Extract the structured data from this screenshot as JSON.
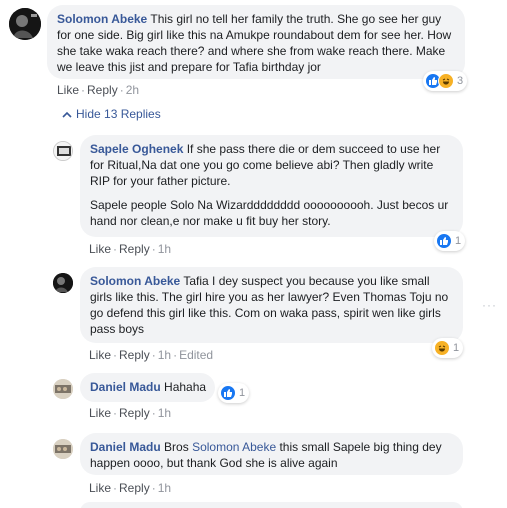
{
  "actions": {
    "like": "Like",
    "reply": "Reply",
    "edited": "Edited"
  },
  "hide_replies": "Hide 13 Replies",
  "comments": [
    {
      "author": "Solomon Abeke",
      "text": "This girl no tell her family the truth. She go see her guy for one side. Big girl like this na Amukpe roundabout dem for see her. How she take waka reach there? and where she from wake reach there. Make we leave this jist and prepare for Tafia birthday jor",
      "time": "2h",
      "reactions": {
        "icons": [
          "like-icon",
          "haha-icon"
        ],
        "count": "3"
      }
    },
    {
      "author": "Sapele Oghenek",
      "text": "If she pass there die or dem succeed to use her for Ritual,Na dat one you go come believe abi? Then gladly write RIP for your father picture.",
      "text2": "Sapele people Solo Na Wizardddddddd oooooooooh. Just becos ur hand nor clean,e nor make u fit buy her story.",
      "time": "1h",
      "reactions": {
        "icons": [
          "like-icon"
        ],
        "count": "1"
      }
    },
    {
      "author": "Solomon Abeke",
      "text": "Tafia I dey suspect you because you like small girls like this. The girl hire you as her lawyer? Even Thomas Toju no go defend this girl like this. Com on waka pass, spirit wen like girls pass boys",
      "time": "1h",
      "reactions": {
        "icons": [
          "haha-icon"
        ],
        "count": "1"
      }
    },
    {
      "author": "Daniel Madu",
      "text": "Hahaha",
      "time": "1h",
      "reactions": {
        "icons": [
          "like-icon"
        ],
        "count": "1"
      }
    },
    {
      "author": "Daniel Madu",
      "text_before": "Bros",
      "mention": "Solomon Abeke",
      "text_after": "this small Sapele big thing dey happen oooo, but thank God she is alive again",
      "time": "1h"
    }
  ],
  "colors": {
    "link": "#385898",
    "bubble": "#f2f3f5",
    "like": "#1877f2",
    "haha": "#f7b125"
  }
}
